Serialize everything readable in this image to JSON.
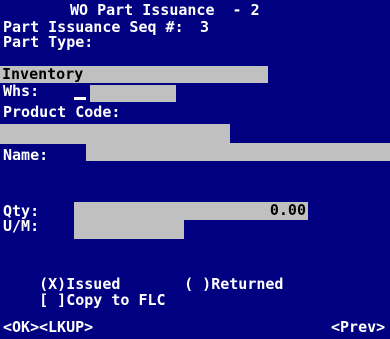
{
  "title": "WO Part Issuance  - 2",
  "seq": {
    "label": "Part Issuance Seq #:",
    "value": "3"
  },
  "part_type": {
    "label": "Part Type:",
    "value": "Inventory"
  },
  "whs": {
    "label": "Whs:",
    "value": ""
  },
  "product_code": {
    "label": "Product Code:",
    "value": ""
  },
  "name": {
    "label": "Name:",
    "value": ""
  },
  "qty": {
    "label": "Qty:",
    "value": "0.00"
  },
  "um": {
    "label": "U/M:",
    "value": ""
  },
  "issued": {
    "mark": "(X)",
    "label": "Issued"
  },
  "returned": {
    "mark": "( )",
    "label": "Returned"
  },
  "copy_flc": {
    "mark": "[ ]",
    "label": "Copy to FLC"
  },
  "buttons": {
    "ok": "<OK>",
    "lkup": "<LKUP>",
    "prev": "<Prev>"
  },
  "colors": {
    "background": "#000080",
    "text": "#ffffff",
    "field": "#c0c0c0",
    "field_text": "#000000"
  }
}
